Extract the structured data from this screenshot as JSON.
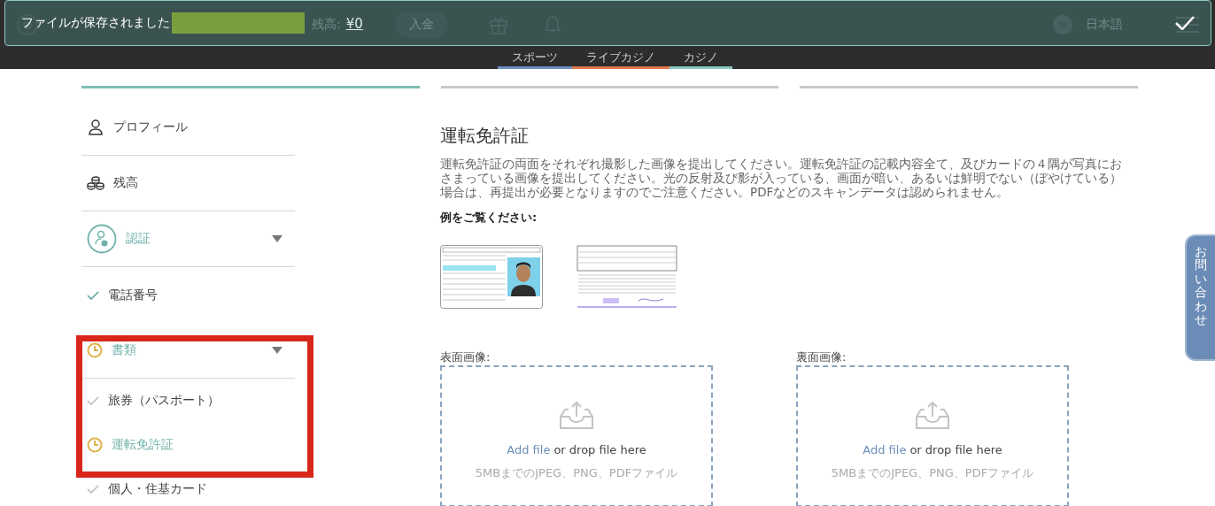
{
  "toast": {
    "message": "ファイルが保存されました"
  },
  "header": {
    "balance_label": "残高:",
    "balance": "¥0",
    "deposit": "入金",
    "language": "日本語"
  },
  "nav_tabs": [
    {
      "label": "スポーツ",
      "color": "#6f8fc4"
    },
    {
      "label": "ライブカジノ",
      "color": "#e0784a"
    },
    {
      "label": "カジノ",
      "color": "#8cc9c0"
    }
  ],
  "steps": [
    {
      "selected": true
    },
    {
      "selected": false
    },
    {
      "selected": false
    }
  ],
  "sidebar": [
    {
      "label": "プロフィール",
      "kind": "profile",
      "selected": false
    },
    {
      "label": "残高",
      "kind": "balance",
      "selected": false
    },
    {
      "label": "認証",
      "kind": "verify",
      "selected": true,
      "expanded": true,
      "children": [
        {
          "label": "電話番号",
          "kind": "verified",
          "selected": false
        },
        {
          "label": "書類",
          "kind": "pending",
          "selected": true,
          "expanded": true,
          "children": [
            {
              "label": "旅券（パスポート）",
              "kind": "submitted",
              "selected": false
            },
            {
              "label": "運転免許証",
              "kind": "pending",
              "selected": true
            },
            {
              "label": "個人・住基カード",
              "kind": "submitted",
              "selected": false
            }
          ]
        }
      ]
    }
  ],
  "main": {
    "title": "運転免許証",
    "description": "運転免許証の両面をそれぞれ撮影した画像を提出してください。運転免許証の記載内容全て、及びカードの４隅が写真におさまっている画像を提出してください。光の反射及び影が入っている、画面が暗い、あるいは鮮明でない（ぼやけている）場合は、再提出が必要となりますのでご注意ください。PDFなどのスキャンデータは認められません。",
    "example_label": "例をご覧ください:",
    "uploads": [
      {
        "label": "表面画像:",
        "link": "Add file",
        "text": "or drop file here",
        "hint": "5MBまでのJPEG、PNG、PDFファイル"
      },
      {
        "label": "裏面画像:",
        "link": "Add file",
        "text": "or drop file here",
        "hint": "5MBまでのJPEG、PNG、PDFファイル"
      }
    ]
  },
  "contact_tab": "お問い合わせ"
}
